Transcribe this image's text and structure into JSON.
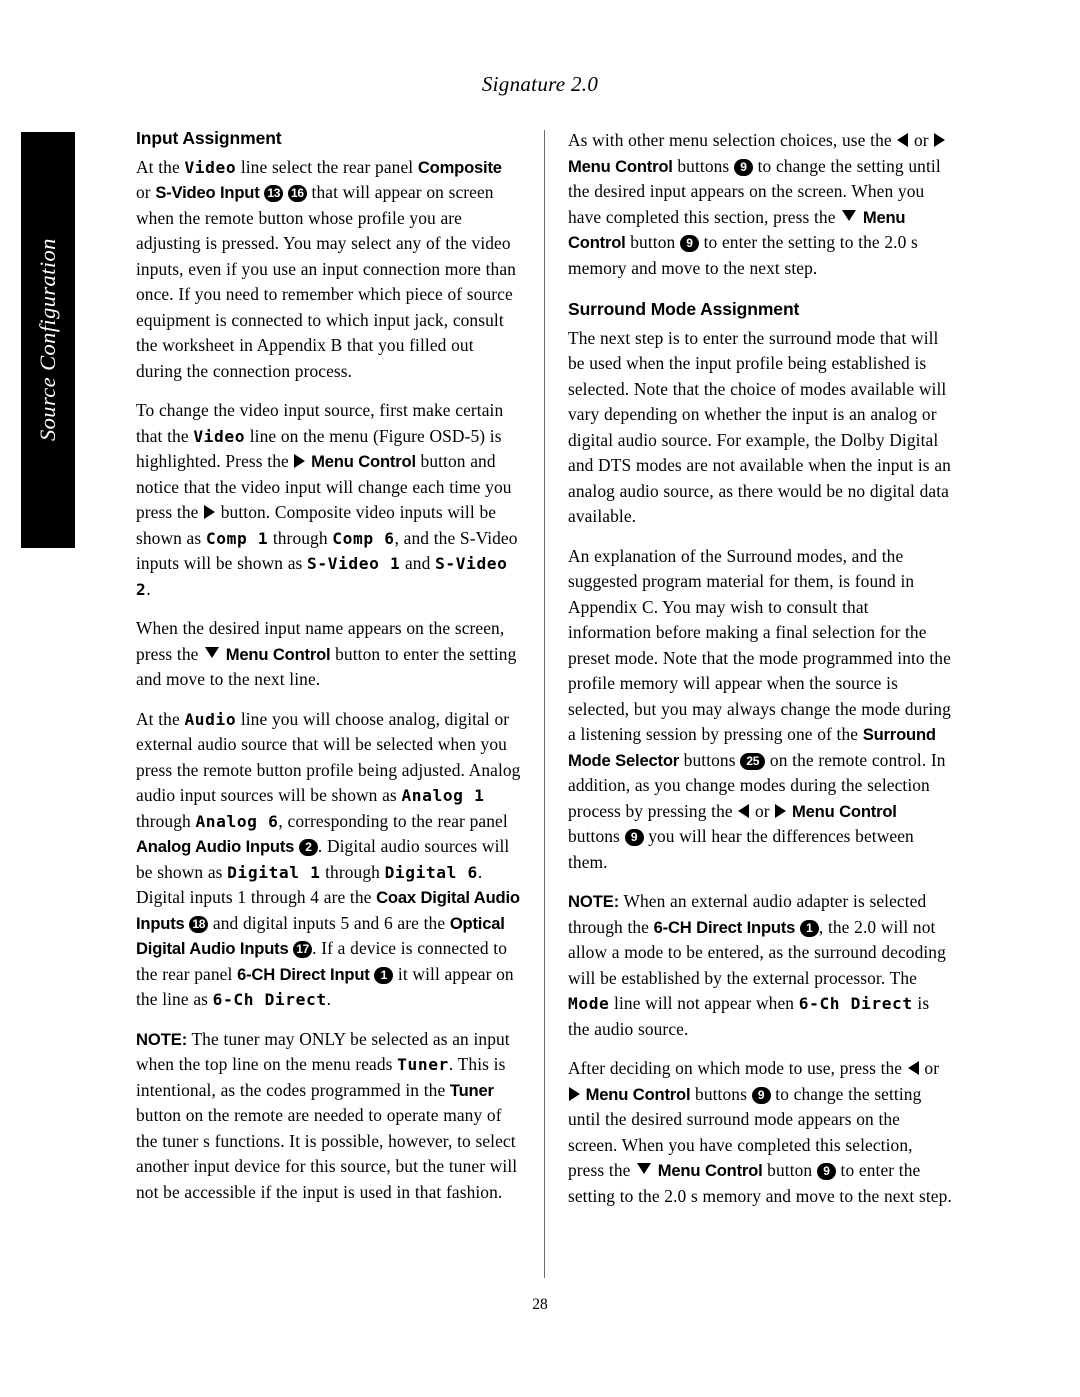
{
  "running_head": "Signature 2.0",
  "side_tab": {
    "label": "Source Configuration",
    "background": "#000000",
    "text_color": "#ffffff"
  },
  "folio": "28",
  "left_column": {
    "heading": "Input Assignment",
    "p1": {
      "t1": "At the ",
      "lcd1": "Video",
      "t2": " line select the rear panel ",
      "ctl1": "Composite",
      "t3": " or ",
      "ctl2": "S-Video Input",
      "c1": "13",
      "c2": "16",
      "t4": " that will appear on screen when the remote button whose profile you are adjusting is pressed. You may select any of the video inputs, even if you use an input connection more than once. If you need to remember which piece of source equipment is connected to which input jack, consult the worksheet in Appendix B that you filled out during the connection process."
    },
    "p2": {
      "t1": "To change the video input source, first make certain that the ",
      "lcd1": "Video",
      "t2": " line on the menu (Figure OSD-5) is highlighted. Press the ",
      "ctl1": "Menu Control",
      "t3": " button and notice that the video input will change each time you press the ",
      "t4": " button. Composite video inputs will be shown as ",
      "lcd2": "Comp 1",
      "t5": " through ",
      "lcd3": "Comp 6",
      "t6": ", and the S-Video inputs will be shown as ",
      "lcd4": "S-Video 1",
      "t7": " and ",
      "lcd5": "S-Video 2",
      "t8": "."
    },
    "p3": {
      "t1": "When the desired input name appears on the screen, press the ",
      "ctl1": "Menu Control",
      "t2": " button to enter the setting and move to the next line."
    },
    "p4": {
      "t1": "At the ",
      "lcd1": "Audio",
      "t2": " line you will choose analog, digital or external audio source that will be selected when you press the remote button profile being adjusted. Analog audio input sources will be shown as ",
      "lcd2": "Analog 1",
      "t3": " through ",
      "lcd3": "Analog 6",
      "t4": ", corresponding to the rear panel ",
      "ctl1": "Analog Audio Inputs",
      "c1": "2",
      "t5": ". Digital audio sources will be shown as ",
      "lcd4": "Digital 1",
      "t6": " through ",
      "lcd5": "Digital 6",
      "t7": ". Digital inputs 1 through 4 are the ",
      "ctl2": "Coax Digital Audio Inputs",
      "c2": "18",
      "t8": " and digital inputs 5 and 6 are the ",
      "ctl3": "Optical Digital Audio Inputs",
      "c3": "17",
      "t9": ". If a device is connected to the rear panel ",
      "ctl4": "6-CH Direct Input",
      "c4": "1",
      "t10": " it will appear on the line as ",
      "lcd6": "6-Ch Direct",
      "t11": "."
    },
    "p5": {
      "note": "NOTE:",
      "t1": " The tuner may ONLY be selected as an input when the top line on the menu reads ",
      "lcd1": "Tuner",
      "t2": ". This is intentional, as the codes programmed in the ",
      "ctl1": "Tuner",
      "t3": " button on the remote are needed to operate many of the tuner s functions. It is possible, however, to select another input device for this source, but the tuner will not be accessible if the input is used in that fashion."
    }
  },
  "right_column": {
    "p1": {
      "t1": "As with other menu selection choices, use the ",
      "t2": " or ",
      "ctl1": "Menu Control",
      "t3": " buttons ",
      "c1": "9",
      "t4": " to change the setting until the desired input appears on the screen. When you have completed this section, press the ",
      "ctl2": "Menu Control",
      "t5": " button ",
      "c2": "9",
      "t6": " to enter the setting to the 2.0 s memory and move to the next step."
    },
    "heading": "Surround Mode Assignment",
    "p2": {
      "t1": "The next step is to enter the surround mode that will be used when the input profile being established is selected. Note that the choice of modes available will vary depending on whether the input is an analog or digital audio source. For example, the Dolby Digital and DTS modes are not available when the input is an analog audio source, as there would be no digital data available."
    },
    "p3": {
      "t1": "An explanation of the Surround modes, and the suggested program material for them, is found in Appendix C. You may wish to consult that information before making a final selection for the preset mode. Note that the mode programmed into the profile memory will appear when the source is selected, but you may always change the mode during a listening session by pressing one of the ",
      "ctl1": "Surround Mode Selector",
      "t2": " buttons ",
      "c1": "25",
      "t3": " on the remote control. In addition, as you change modes during the selection process by pressing the ",
      "t4": " or ",
      "ctl2": "Menu Control",
      "t5": " buttons ",
      "c2": "9",
      "t6": " you will hear the differences between them."
    },
    "p4": {
      "note": "NOTE:",
      "t1": " When an external audio adapter is selected through the ",
      "ctl1": "6-CH Direct Inputs",
      "c1": "1",
      "t2": ", the 2.0 will not allow a mode to be entered, as the surround decoding will be established by the external processor. The ",
      "lcd1": "Mode",
      "t3": " line will not appear when ",
      "lcd2": "6-Ch Direct",
      "t4": " is the audio source."
    },
    "p5": {
      "t1": "After deciding on which mode to use, press the ",
      "t2": " or ",
      "ctl1": "Menu Control",
      "t3": " buttons ",
      "c1": "9",
      "t4": " to change the setting until the desired surround mode appears on the screen. When you have completed this selection, press the ",
      "ctl2": "Menu",
      "ctl2b": "Control",
      "t5": " button ",
      "c2": "9",
      "t6": " to enter the setting to the 2.0 s memory and move to the next step."
    }
  }
}
